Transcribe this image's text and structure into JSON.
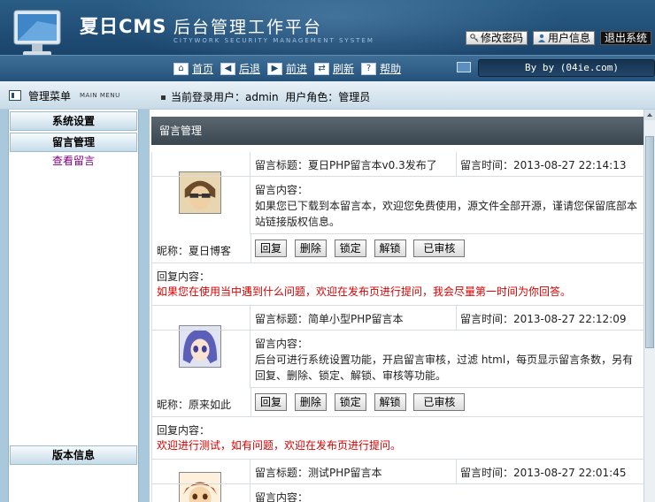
{
  "header": {
    "brand": "夏日CMS",
    "title": "后台管理工作平台",
    "subtitle": "CITYWORK SECURITY MANAGEMENT SYSTEM",
    "buttons": {
      "change_password": "修改密码",
      "user_info": "用户信息",
      "logout": "退出系统"
    },
    "byline": "By by (04ie.com)"
  },
  "nav": {
    "home": "首页",
    "back": "后退",
    "forward": "前进",
    "refresh": "刷新",
    "help": "帮助"
  },
  "status": {
    "menu_title": "管理菜单",
    "menu_sub": "MAIN MENU",
    "login_label": "当前登录用户：",
    "login_user": "admin",
    "role_label": "用户角色：",
    "role": "管理员"
  },
  "sidebar": {
    "groups": [
      {
        "label": "系统设置"
      },
      {
        "label": "留言管理",
        "items": [
          "查看留言"
        ]
      }
    ],
    "version": "版本信息"
  },
  "main": {
    "panel_title": "留言管理",
    "buttons": [
      "回复",
      "删除",
      "锁定",
      "解锁",
      "已审核"
    ],
    "entries": [
      {
        "title_label": "留言标题：",
        "title": "夏日PHP留言本v0.3发布了",
        "time_label": "留言时间：",
        "time": "2013-08-27 22:14:13",
        "content_label": "留言内容：",
        "content": "如果您已下载到本留言本，欢迎您免费使用，源文件全部开源，谨请您保留底部本站链接版权信息。",
        "nick_label": "昵称：",
        "nick": "夏日博客",
        "reply_label": "回复内容：",
        "reply": "如果您在使用当中遇到什么问题，欢迎在发布页进行提问，我会尽量第一时间为你回答。"
      },
      {
        "title_label": "留言标题：",
        "title": "简单小型PHP留言本",
        "time_label": "留言时间：",
        "time": "2013-08-27 22:12:09",
        "content_label": "留言内容：",
        "content": "后台可进行系统设置功能，开启留言审核，过滤 html，每页显示留言条数，另有回复、删除、锁定、解锁、审核等功能。",
        "nick_label": "昵称：",
        "nick": "原来如此",
        "reply_label": "回复内容：",
        "reply": "欢迎进行测试，如有问题，欢迎在发布页进行提问。"
      },
      {
        "title_label": "留言标题：",
        "title": "测试PHP留言本",
        "time_label": "留言时间：",
        "time": "2013-08-27 22:01:45",
        "content_label": "留言内容："
      }
    ]
  },
  "colors": {
    "header": "#1d4870",
    "panel_title": "#47535c",
    "reply": "#dd0000",
    "link": "#800080"
  }
}
